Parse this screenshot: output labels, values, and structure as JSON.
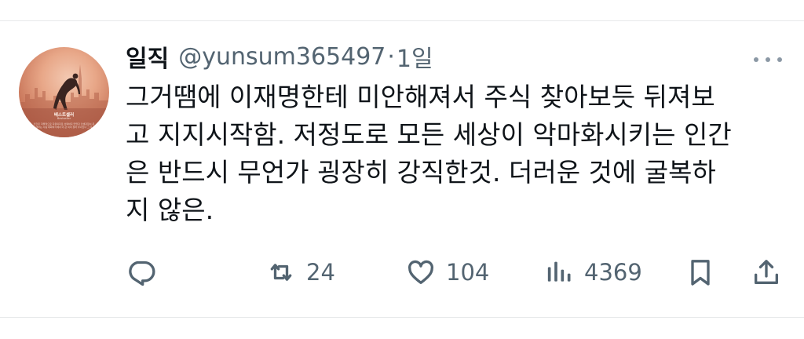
{
  "tweet": {
    "author_name": "일직",
    "handle": "@yunsum365497",
    "separator": "·",
    "time": "1일",
    "text": "그거땜에 이재명한테 미안해져서 주식 찾아보듯 뒤져보\n고 지지시작함. 저정도로 모든 세상이 악마화시키는 인간\n은 반드시 무언가 굉장히 강직한것. 더러운 것에 굴복하\n지 않은."
  },
  "avatar": {
    "title": "베스트셀러",
    "subtitle": "Bestseller",
    "body": "인간은 자율적으로 자유의지로 선택하지 않았다 인생지침서 운영하는 사람 대화하기에서 더 큰 의미 찾아 무너진다 그 후"
  },
  "actions": {
    "reply_icon": "reply-icon",
    "retweet_icon": "retweet-icon",
    "retweet_count": "24",
    "like_icon": "heart-icon",
    "like_count": "104",
    "views_icon": "views-chart-icon",
    "views_count": "4369",
    "bookmark_icon": "bookmark-icon",
    "share_icon": "share-icon"
  },
  "colors": {
    "text_primary": "#0f1419",
    "text_secondary": "#536471",
    "divider": "#e7e9ea"
  }
}
